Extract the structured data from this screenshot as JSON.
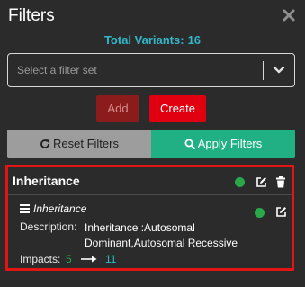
{
  "header": {
    "title": "Filters",
    "close_icon": "close-icon"
  },
  "summary": {
    "label": "Total Variants:",
    "count": "16"
  },
  "filter_set_select": {
    "placeholder": "Select a filter set",
    "icon": "chevron-down-icon"
  },
  "actions": {
    "add_label": "Add",
    "create_label": "Create"
  },
  "toolbar": {
    "reset_label": "Reset Filters",
    "reset_icon": "reload-icon",
    "apply_label": "Apply Filters",
    "apply_icon": "search-icon"
  },
  "filter_card": {
    "title": "Inheritance",
    "status_color": "#29a84a",
    "border_color": "#e21515",
    "rule": {
      "name": "Inheritance",
      "description_label": "Description:",
      "description": "Inheritance :Autosomal Dominant,Autosomal Recessive",
      "impacts_label": "Impacts:",
      "impacts_from": "5",
      "impacts_to": "11"
    }
  },
  "colors": {
    "background": "#2b2b2b",
    "accent_teal": "#33b6c9",
    "apply_green": "#21b083",
    "create_red": "#e1000f",
    "add_disabled": "#8c1c1c",
    "reset_gray": "#9d9d9d"
  }
}
